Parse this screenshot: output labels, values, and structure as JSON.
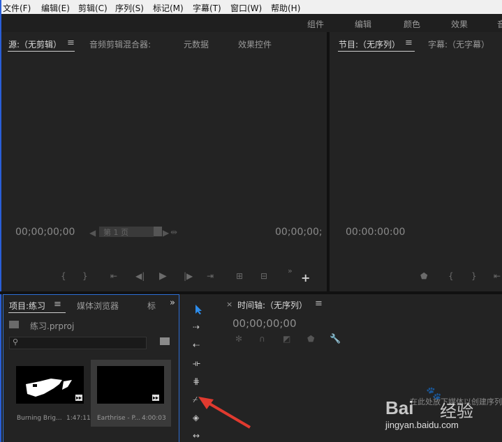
{
  "menu": [
    "文件(F)",
    "编辑(E)",
    "剪辑(C)",
    "序列(S)",
    "标记(M)",
    "字幕(T)",
    "窗口(W)",
    "帮助(H)"
  ],
  "workspace_tabs": [
    "组件",
    "编辑",
    "颜色",
    "效果",
    "音"
  ],
  "source_panel": {
    "tabs": [
      "源:（无剪辑）",
      "音频剪辑混合器:",
      "元数据",
      "效果控件"
    ],
    "timecode_left": "00;00;00;00",
    "page_label": "第 1 页",
    "timecode_right": "00;00;00;"
  },
  "program_panel": {
    "tabs": [
      "节目:（无序列）",
      "字幕:（无字幕）"
    ],
    "timecode_left": "00:00:00:00"
  },
  "project_panel": {
    "tabs": [
      "项目:练习",
      "媒体浏览器",
      "标"
    ],
    "project_file": "练习.prproj",
    "search_placeholder": "",
    "items": [
      {
        "name": "Burning Brig...",
        "duration": "1:47:11"
      },
      {
        "name": "Earthrise - P...",
        "duration": "4:00:03"
      }
    ]
  },
  "timeline_panel": {
    "close": "×",
    "title": "时间轴:（无序列）",
    "timecode": "00;00;00;00"
  },
  "watermark": {
    "logo_text": "Bai",
    "logo_text2": "经验",
    "url": "jingyan.baidu.com",
    "overlay": "在此处放下媒体以创建序列"
  },
  "colors": {
    "accent": "#2d8ceb",
    "arrow": "#e03a2f",
    "menu_bg": "#f0f0f0",
    "panel_bg": "#232323"
  }
}
